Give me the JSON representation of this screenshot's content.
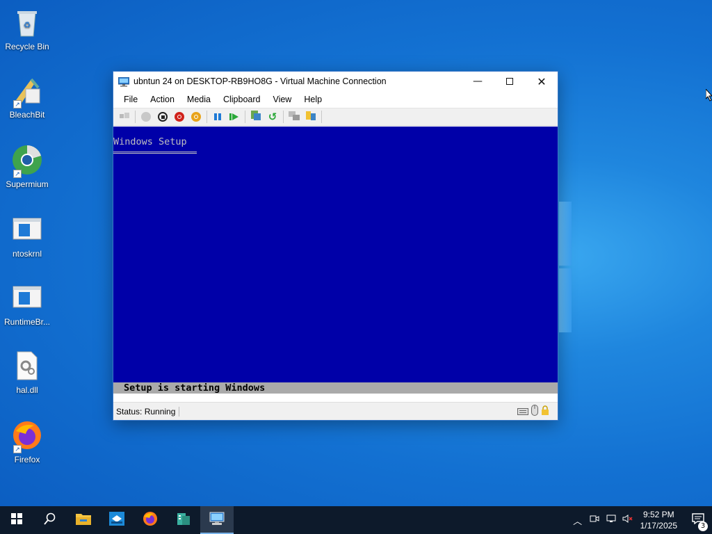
{
  "desktop": {
    "icons": [
      {
        "label": "Recycle Bin"
      },
      {
        "label": "BleachBit"
      },
      {
        "label": "Supermium"
      },
      {
        "label": "ntoskrnl"
      },
      {
        "label": "RuntimeBr..."
      },
      {
        "label": "hal.dll"
      },
      {
        "label": "Firefox"
      }
    ]
  },
  "window": {
    "title": "ubntun 24 on DESKTOP-RB9HO8G - Virtual Machine Connection",
    "menu": [
      "File",
      "Action",
      "Media",
      "Clipboard",
      "View",
      "Help"
    ],
    "toolbar_icons": [
      "ctrl-alt-del-icon",
      "start-icon",
      "turn-off-icon",
      "shutdown-icon",
      "save-icon",
      "pause-icon",
      "resume-icon",
      "checkpoint-icon",
      "revert-icon",
      "enhanced-session-icon",
      "share-icon"
    ],
    "screen": {
      "setup_title": "Windows Setup",
      "setup_status": "Setup is starting Windows"
    },
    "status": "Status: Running"
  },
  "taskbar": {
    "clock_time": "9:52 PM",
    "clock_date": "1/17/2025",
    "notification_count": "3"
  }
}
